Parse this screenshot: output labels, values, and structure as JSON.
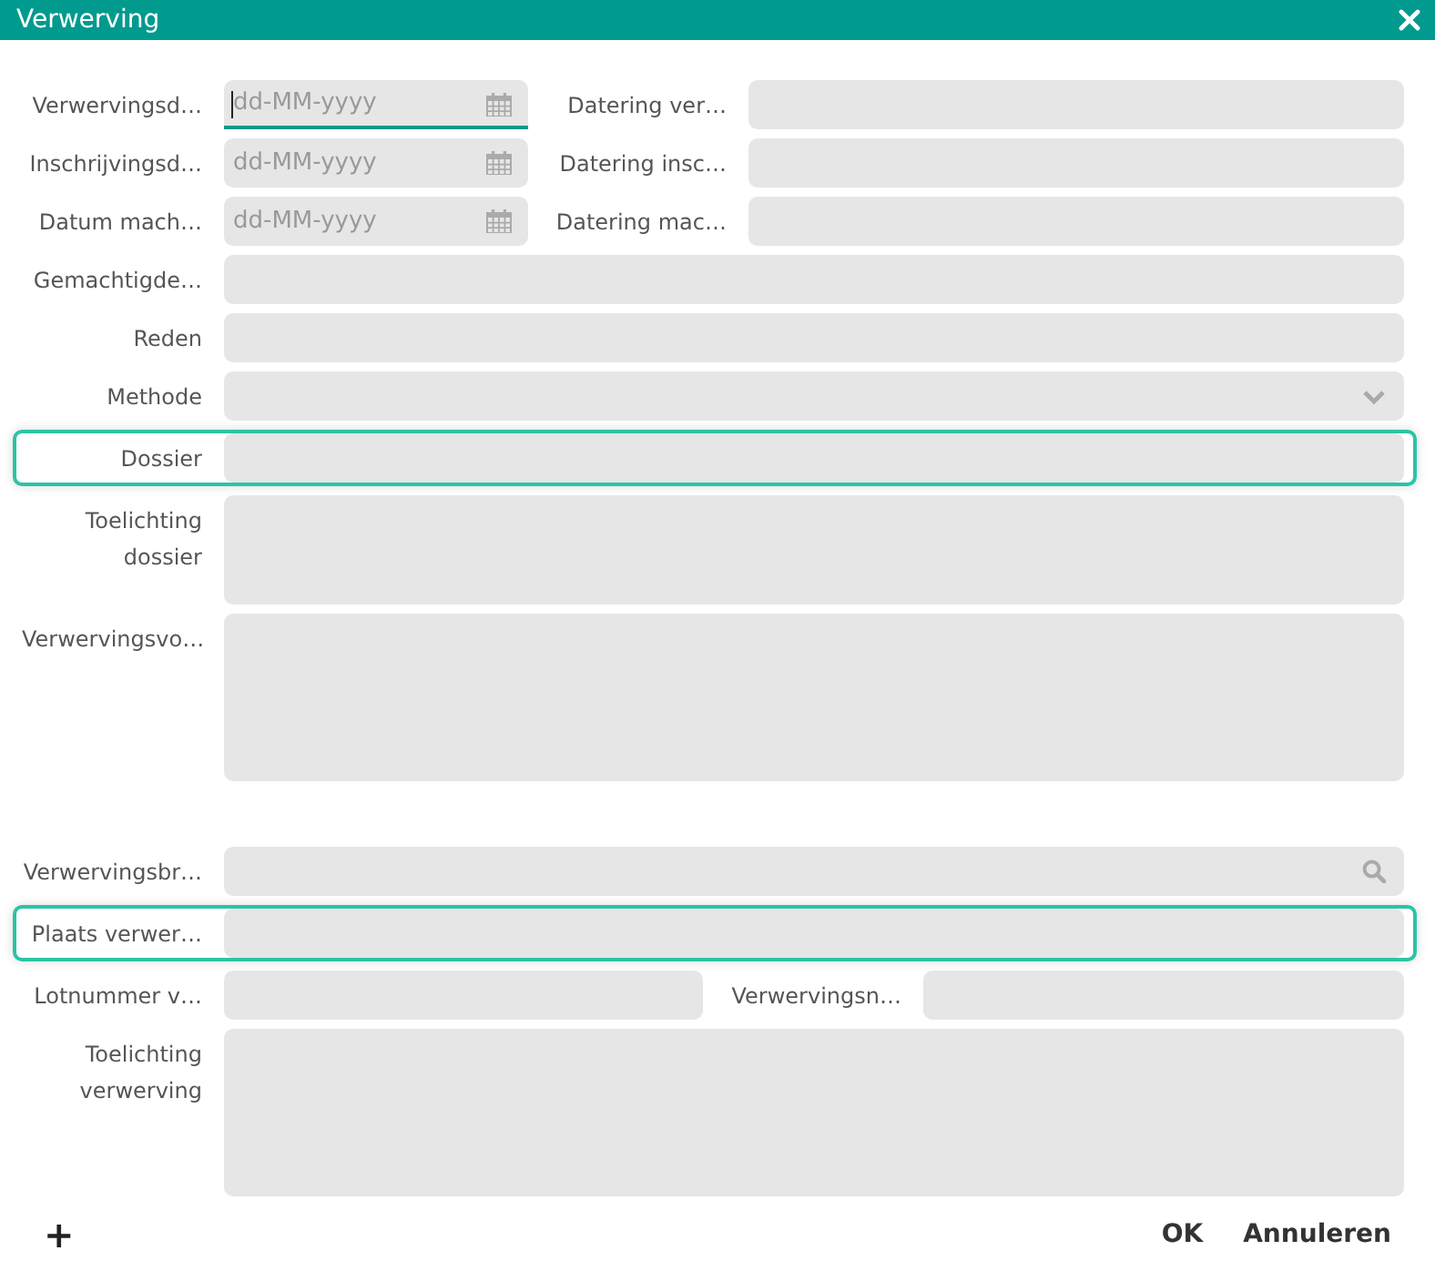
{
  "window": {
    "title": "Verwerving"
  },
  "sections": [
    {
      "fields": [
        {
          "kind": "date_pair",
          "label": "Verwervingsd…",
          "placeholder": "dd-MM-yyyy",
          "focused": true,
          "second_label": "Datering ver…"
        },
        {
          "kind": "date_pair",
          "label": "Inschrijvingsd…",
          "placeholder": "dd-MM-yyyy",
          "focused": false,
          "second_label": "Datering insc…"
        },
        {
          "kind": "date_pair",
          "label": "Datum mach…",
          "placeholder": "dd-MM-yyyy",
          "focused": false,
          "second_label": "Datering mac…"
        },
        {
          "kind": "text",
          "label": "Gemachtigde…",
          "highlighted": false
        },
        {
          "kind": "text",
          "label": "Reden",
          "highlighted": false
        },
        {
          "kind": "select",
          "label": "Methode"
        },
        {
          "kind": "text",
          "label": "Dossier",
          "highlighted": true
        },
        {
          "kind": "note",
          "label": "Toelichting dossier"
        },
        {
          "kind": "memo",
          "label": "Verwervingsvo…"
        }
      ]
    },
    {
      "fields": [
        {
          "kind": "lookup",
          "label": "Verwervingsbr…"
        },
        {
          "kind": "text",
          "label": "Plaats verwer…",
          "highlighted": true
        },
        {
          "kind": "pair",
          "label": "Lotnummer v…",
          "second_label": "Verwervingsn…"
        },
        {
          "kind": "memo",
          "label": "Toelichting verwerving"
        }
      ]
    }
  ],
  "footer": {
    "add_button": "+",
    "buttons": [
      "OK",
      "Annuleren"
    ]
  }
}
